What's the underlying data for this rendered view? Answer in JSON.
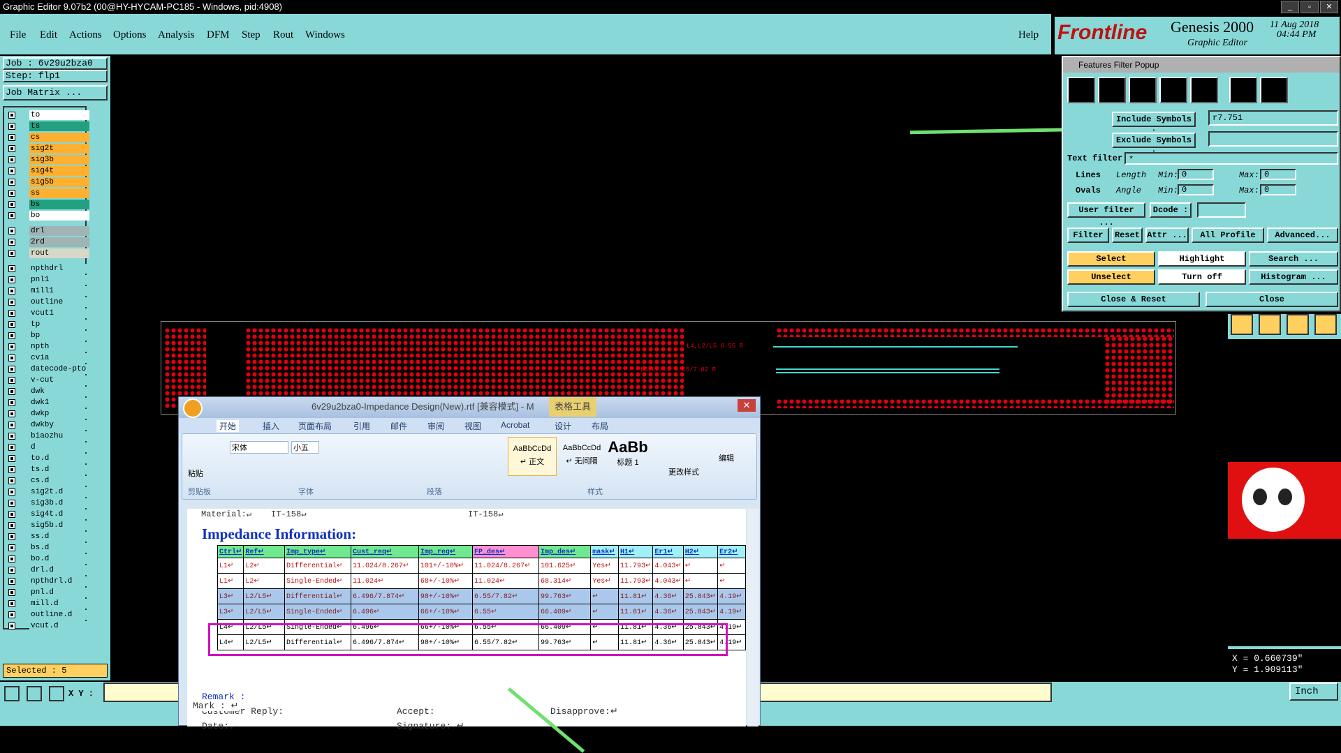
{
  "window": {
    "title": "Graphic Editor 9.07b2 (00@HY-HYCAM-PC185 - Windows, pid:4908)"
  },
  "menu": {
    "items": [
      "File",
      "Edit",
      "Actions",
      "Options",
      "Analysis",
      "DFM",
      "Step",
      "Rout",
      "Windows"
    ],
    "help": "Help"
  },
  "logo": {
    "brand": "Frontline",
    "product": "Genesis 2000",
    "subtitle": "Graphic Editor",
    "date": "11 Aug 2018",
    "time": "04:44 PM"
  },
  "job": {
    "job": "Job : 6v29u2bza0",
    "step": "Step: flp1",
    "matrix": "Job Matrix ..."
  },
  "layers": [
    {
      "name": "to",
      "color": "#ffffff"
    },
    {
      "name": "ts",
      "color": "#22a080"
    },
    {
      "name": "cs",
      "color": "#ffb030"
    },
    {
      "name": "sig2t",
      "color": "#ffb030"
    },
    {
      "name": "sig3b",
      "color": "#ffb030"
    },
    {
      "name": "sig4t",
      "color": "#ffb030"
    },
    {
      "name": "sig5b",
      "color": "#ffb030"
    },
    {
      "name": "ss",
      "color": "#ffb030"
    },
    {
      "name": "bs",
      "color": "#22a080"
    },
    {
      "name": "bo",
      "color": "#ffffff"
    },
    {
      "name": "drl",
      "color": "#a0b4b4"
    },
    {
      "name": "2rd",
      "color": "#a0b4b4"
    },
    {
      "name": "rout",
      "color": "#d8d8c8"
    },
    {
      "name": "npthdrl",
      "color": "#88d8d8"
    },
    {
      "name": "pnl1",
      "color": "#88d8d8"
    },
    {
      "name": "mill1",
      "color": "#88d8d8"
    },
    {
      "name": "outline",
      "color": "#88d8d8"
    },
    {
      "name": "vcut1",
      "color": "#88d8d8"
    },
    {
      "name": "tp",
      "color": "#88d8d8"
    },
    {
      "name": "bp",
      "color": "#88d8d8"
    },
    {
      "name": "npth",
      "color": "#88d8d8"
    },
    {
      "name": "cvia",
      "color": "#88d8d8"
    },
    {
      "name": "datecode-pto",
      "color": "#88d8d8"
    },
    {
      "name": "v-cut",
      "color": "#88d8d8"
    },
    {
      "name": "dwk",
      "color": "#88d8d8"
    },
    {
      "name": "dwk1",
      "color": "#88d8d8"
    },
    {
      "name": "dwkp",
      "color": "#88d8d8"
    },
    {
      "name": "dwkby",
      "color": "#88d8d8"
    },
    {
      "name": "biaozhu",
      "color": "#88d8d8"
    },
    {
      "name": "d",
      "color": "#88d8d8"
    },
    {
      "name": "to.d",
      "color": "#88d8d8"
    },
    {
      "name": "ts.d",
      "color": "#88d8d8"
    },
    {
      "name": "cs.d",
      "color": "#88d8d8"
    },
    {
      "name": "sig2t.d",
      "color": "#88d8d8"
    },
    {
      "name": "sig3b.d",
      "color": "#88d8d8"
    },
    {
      "name": "sig4t.d",
      "color": "#88d8d8"
    },
    {
      "name": "sig5b.d",
      "color": "#88d8d8"
    },
    {
      "name": "ss.d",
      "color": "#88d8d8"
    },
    {
      "name": "bs.d",
      "color": "#88d8d8"
    },
    {
      "name": "bo.d",
      "color": "#88d8d8"
    },
    {
      "name": "drl.d",
      "color": "#88d8d8"
    },
    {
      "name": "npthdrl.d",
      "color": "#88d8d8"
    },
    {
      "name": "pnl.d",
      "color": "#88d8d8"
    },
    {
      "name": "mill.d",
      "color": "#88d8d8"
    },
    {
      "name": "outline.d",
      "color": "#88d8d8"
    },
    {
      "name": "vcut.d",
      "color": "#88d8d8"
    }
  ],
  "status": {
    "selected": "Selected : 5",
    "xy_label": "X Y :",
    "unit": "Inch",
    "x": "X = 0.660739\"",
    "y": "Y = 1.909113\""
  },
  "pcb": {
    "label1": "L4,L2/L5 6.55 R",
    "label2": "L4,L2/L5 6.55/7.82 R"
  },
  "ffp": {
    "title": "Features Filter Popup",
    "include_label": "Include Symbols :",
    "include_value": "r7.751",
    "exclude_label": "Exclude Symbols :",
    "exclude_value": "",
    "text_filter_label": "Text filter",
    "text_filter_value": "*",
    "lines": "Lines",
    "ovals": "Ovals",
    "length": "Length",
    "angle": "Angle",
    "min": "Min:",
    "max": "Max:",
    "zero": "0",
    "user_filter": "User filter ...",
    "dcode": "Dcode :",
    "filter": "Filter",
    "reset": "Reset",
    "attr": "Attr ...",
    "all_profile": "All Profile",
    "advanced": "Advanced...",
    "select": "Select",
    "highlight": "Highlight",
    "search": "Search ...",
    "unselect": "Unselect",
    "turn_off": "Turn off",
    "histogram": "Histogram ...",
    "close_reset": "Close & Reset",
    "close": "Close"
  },
  "word": {
    "title": "6v29u2bza0-Impedance Design(New).rtf [兼容模式] - M",
    "table_tools": "表格工具",
    "tabs": [
      "开始",
      "插入",
      "页面布局",
      "引用",
      "邮件",
      "审阅",
      "视图",
      "Acrobat",
      "设计",
      "布局"
    ],
    "paste": "粘贴",
    "font_name": "宋体",
    "font_size": "小五",
    "styles": [
      {
        "sample": "AaBbCcDd",
        "name": "↵ 正文"
      },
      {
        "sample": "AaBbCcDd",
        "name": "↵ 无间隔"
      },
      {
        "sample": "AaBb",
        "name": "标题 1"
      }
    ],
    "change_styles": "更改样式",
    "edit": "编辑",
    "groups": [
      "剪贴板",
      "字体",
      "段落",
      "样式"
    ],
    "material": "Material:↵",
    "material_val": "IT-158↵",
    "material_val2": "IT-158↵",
    "heading": "Impedance Information:",
    "table_header": [
      "Ctrl↵",
      "Ref↵",
      "Imp_type↵",
      "Cust_req↵",
      "Imp_req↵",
      "FP_des↵",
      "Imp_des↵",
      "mask↵",
      "H1↵",
      "Er1↵",
      "H2↵",
      "Er2↵"
    ],
    "rows": [
      [
        "L1↵",
        "L2↵",
        "Differential↵",
        "11.024/8.267↵",
        "101+/-10%↵",
        "11.024/8.267↵",
        "101.625↵",
        "Yes↵",
        "11.793↵",
        "4.043↵",
        "↵",
        "↵"
      ],
      [
        "L1↵",
        "L2↵",
        "Single-Ended↵",
        "11.024↵",
        "68+/-10%↵",
        "11.024↵",
        "68.314↵",
        "Yes↵",
        "11.793↵",
        "4.043↵",
        "↵",
        "↵"
      ],
      [
        "L3↵",
        "L2/L5↵",
        "Differential↵",
        "6.496/7.874↵",
        "98+/-10%↵",
        "6.55/7.82↵",
        "99.763↵",
        "↵",
        "11.81↵",
        "4.36↵",
        "25.843↵",
        "4.19↵"
      ],
      [
        "L3↵",
        "L2/L5↵",
        "Single-Ended↵",
        "6.496↵",
        "66+/-10%↵",
        "6.55↵",
        "66.409↵",
        "↵",
        "11.81↵",
        "4.36↵",
        "25.843↵",
        "4.19↵"
      ],
      [
        "L4↵",
        "L2/L5↵",
        "Single-Ended↵",
        "6.496↵",
        "66+/-10%↵",
        "6.55↵",
        "66.409↵",
        "↵",
        "11.81↵",
        "4.36↵",
        "25.843↵",
        "4.19↵"
      ],
      [
        "L4↵",
        "L2/L5↵",
        "Differential↵",
        "6.496/7.874↵",
        "98+/-10%↵",
        "6.55/7.82↵",
        "99.763↵",
        "↵",
        "11.81↵",
        "4.36↵",
        "25.843↵",
        "4.19↵"
      ]
    ],
    "remark": "Remark :",
    "customer_reply": "Customer Reply:",
    "accept": "Accept:",
    "disapprove": "Disapprove:↵",
    "date": "Date:.",
    "signature": "Signature: ↵",
    "mark": "Mark : ↵"
  },
  "colors": {
    "teal": "#88d8d8",
    "pcb_red": "#e00010",
    "trace": "#40d8d0",
    "highlight_box": "#d010c0",
    "arrow": "#70e070"
  }
}
